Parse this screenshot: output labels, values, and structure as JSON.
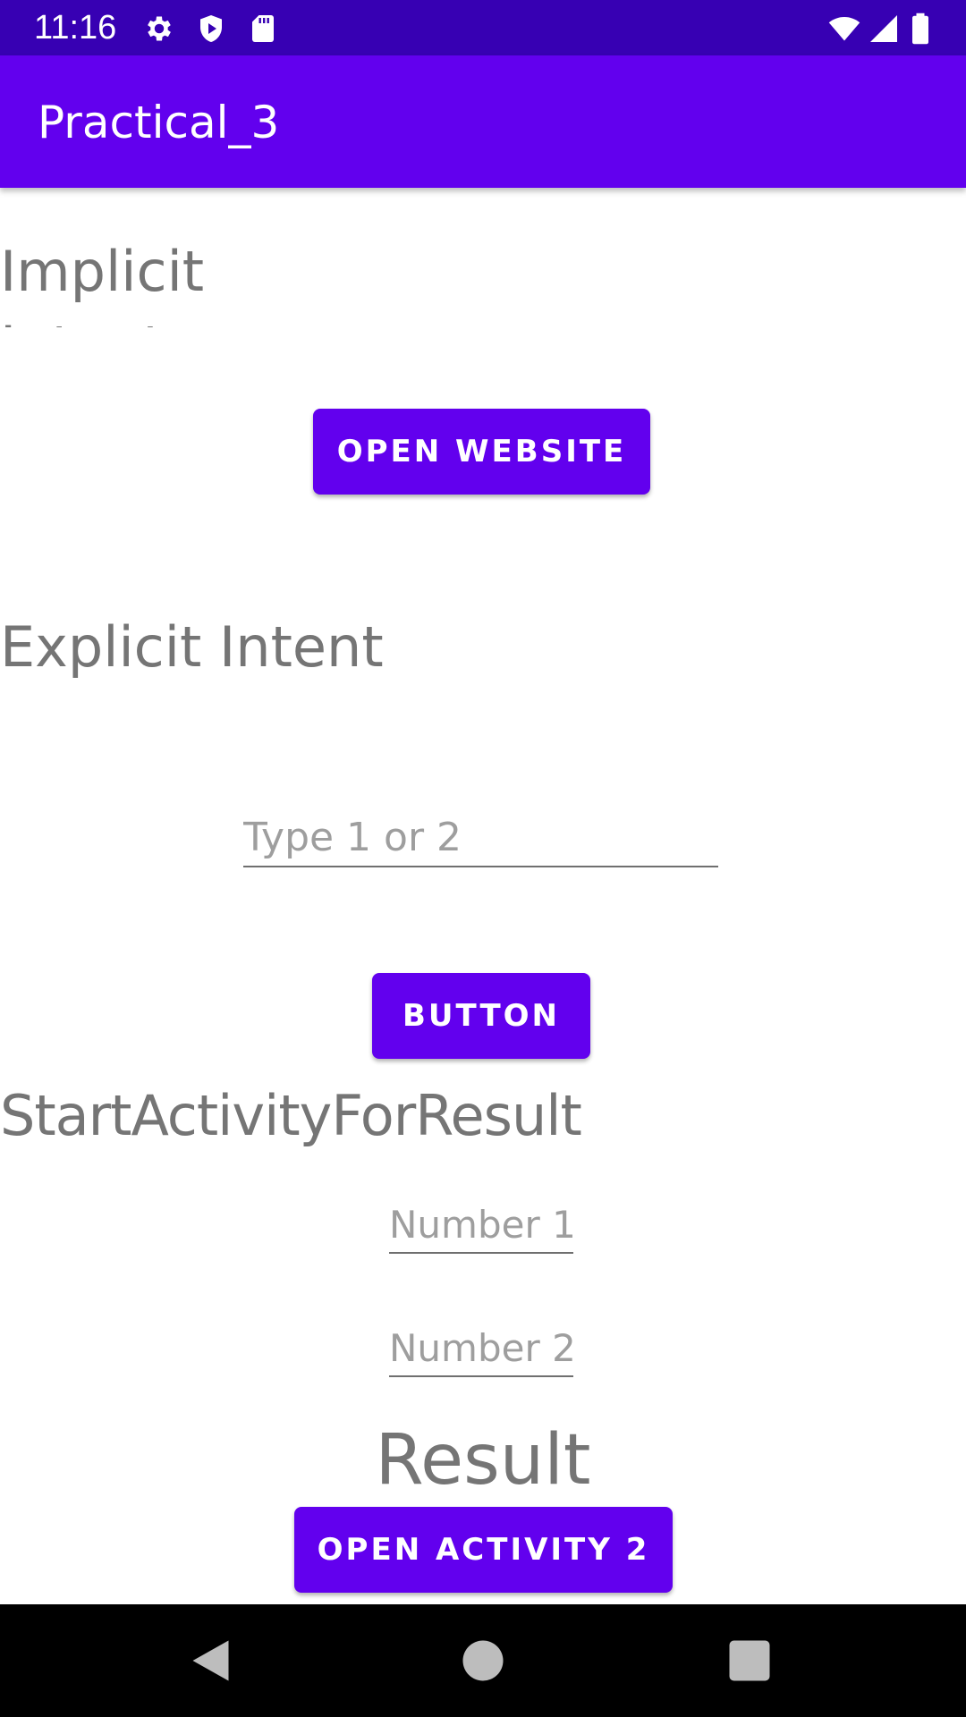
{
  "status_bar": {
    "time": "11:16",
    "icons": [
      "gear-icon",
      "shield-icon",
      "sd-card-icon",
      "wifi-icon",
      "signal-icon",
      "battery-icon"
    ]
  },
  "app_bar": {
    "title": "Practical_3"
  },
  "sections": {
    "implicit_label": "Implicit Intent",
    "open_website_label": "OPEN WEBSITE",
    "explicit_label": "Explicit Intent",
    "type_input_placeholder": "Type 1 or 2",
    "button_label": "BUTTON",
    "start_activity_label": "StartActivityForResult",
    "number1_placeholder": "Number 1",
    "number2_placeholder": "Number 2",
    "result_label": "Result",
    "open_activity2_label": "OPEN ACTIVITY 2"
  },
  "nav_bar": {
    "icons": [
      "back-icon",
      "home-icon",
      "recents-icon"
    ]
  },
  "colors": {
    "status_bar": "#3700B3",
    "primary": "#6200EE",
    "text_gray": "#757575",
    "hint_gray": "#9e9e9e"
  }
}
